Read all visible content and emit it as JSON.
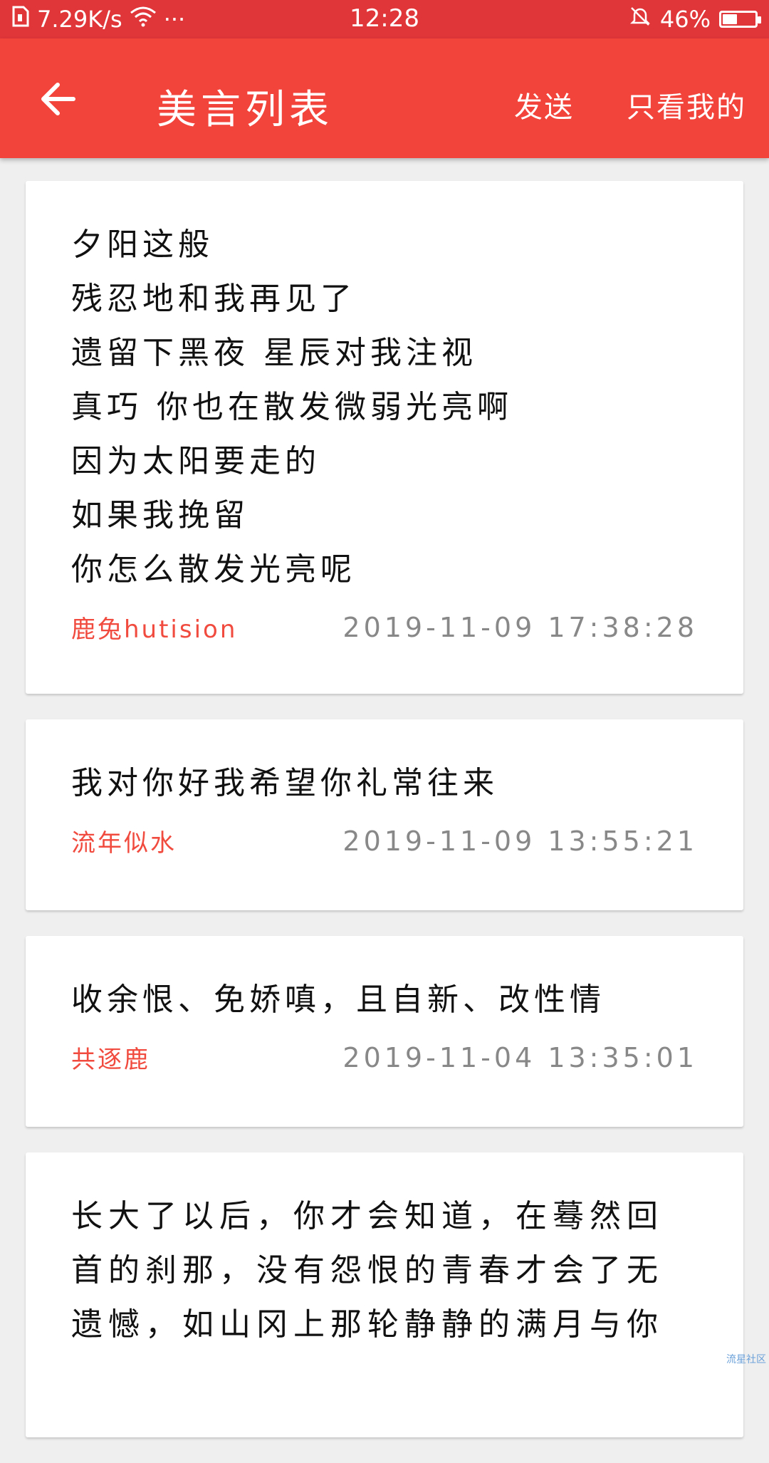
{
  "status": {
    "speed": "7.29K/s",
    "dots": "···",
    "time": "12:28",
    "battery": "46%",
    "battery_level": 0.46
  },
  "appbar": {
    "title": "美言列表",
    "send_label": "发送",
    "mine_label": "只看我的"
  },
  "posts": [
    {
      "content": "夕阳这般\n残忍地和我再见了\n遗留下黑夜 星辰对我注视\n真巧 你也在散发微弱光亮啊\n因为太阳要走的\n如果我挽留\n你怎么散发光亮呢",
      "author": "鹿兔hutision",
      "time": "2019-11-09 17:38:28"
    },
    {
      "content": "我对你好我希望你礼常往来",
      "author": "流年似水",
      "time": "2019-11-09 13:55:21"
    },
    {
      "content": "收余恨、免娇嗔，且自新、改性情",
      "author": "共逐鹿",
      "time": "2019-11-04 13:35:01"
    },
    {
      "content": "长大了以后，你才会知道，在蓦然回首的刹那，没有怨恨的青春才会了无遗憾，如山冈上那轮静静的满月与你",
      "author": "",
      "time": ""
    }
  ],
  "watermark": "流星社区"
}
